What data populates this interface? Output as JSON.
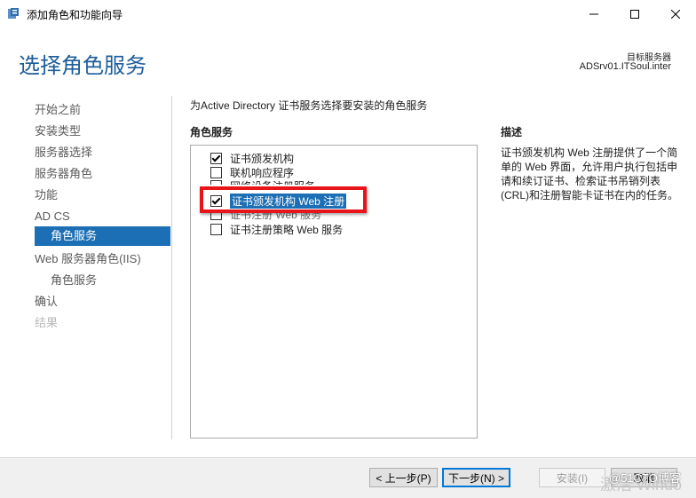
{
  "window": {
    "title": "添加角色和功能向导",
    "icon": "server-manager-icon",
    "minimize": "—",
    "maximize": "☐",
    "close": "✕"
  },
  "header": {
    "page_title": "选择角色服务",
    "target_label": "目标服务器",
    "target_value": "ADSrv01.ITSoul.inter"
  },
  "nav": {
    "items": [
      {
        "label": "开始之前"
      },
      {
        "label": "安装类型"
      },
      {
        "label": "服务器选择"
      },
      {
        "label": "服务器角色"
      },
      {
        "label": "功能"
      },
      {
        "label": "AD CS"
      },
      {
        "label": "角色服务"
      },
      {
        "label": "Web 服务器角色(IIS)"
      },
      {
        "label": "角色服务"
      },
      {
        "label": "确认"
      },
      {
        "label": "结果"
      }
    ]
  },
  "main": {
    "description": "为Active Directory 证书服务选择要安装的角色服务",
    "services_header": "角色服务",
    "services": [
      {
        "label": "证书颁发机构",
        "checked": true
      },
      {
        "label": "联机响应程序",
        "checked": false
      },
      {
        "label": "网络设备注册服务",
        "checked": false
      },
      {
        "label": "证书颁发机构 Web 注册",
        "checked": true
      },
      {
        "label": "证书注册 Web 服务",
        "checked": false
      },
      {
        "label": "证书注册策略 Web 服务",
        "checked": false
      }
    ],
    "desc_header": "描述",
    "desc_body": "证书颁发机构 Web 注册提供了一个简单的 Web 界面，允许用户执行包括申请和续订证书、检索证书吊销列表(CRL)和注册智能卡证书在内的任务。"
  },
  "footer": {
    "prev": "< 上一步(P)",
    "next": "下一步(N) >",
    "install": "安装(I)",
    "cancel": "取消"
  },
  "watermark": {
    "text1": "@51CTO博客",
    "text2": "激活 Windo"
  },
  "colors": {
    "accent": "#1c6fb4",
    "title_blue": "#1c5d99",
    "highlight_red": "#e8141a"
  }
}
